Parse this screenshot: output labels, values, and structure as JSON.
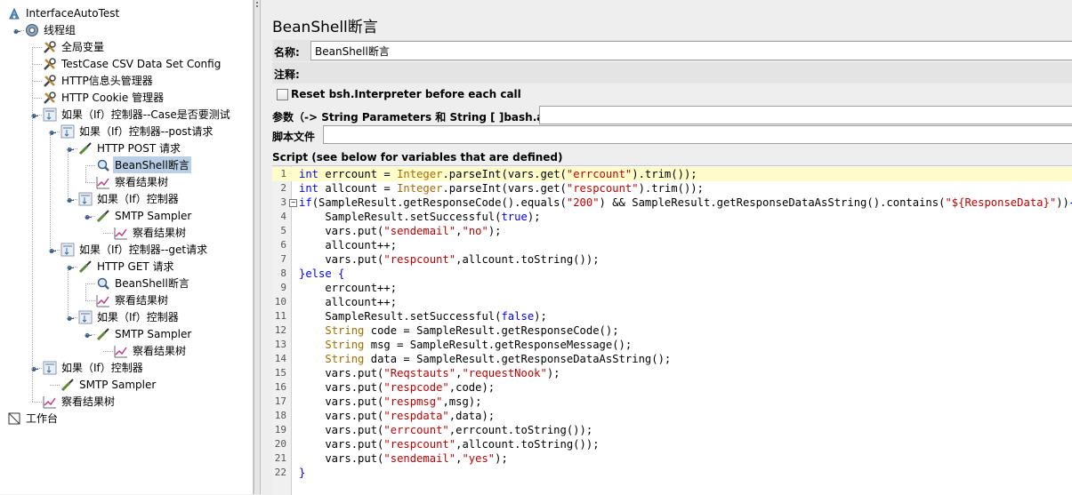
{
  "tree": {
    "items": [
      {
        "label": "InterfaceAutoTest",
        "level": 0,
        "icon": "testplan-icon",
        "toggle": "none",
        "selected": false
      },
      {
        "label": "线程组",
        "level": 1,
        "icon": "gear-icon",
        "toggle": "open",
        "selected": false
      },
      {
        "label": "全局变量",
        "level": 2,
        "icon": "wrench-icon",
        "toggle": "none",
        "selected": false
      },
      {
        "label": "TestCase CSV Data Set Config",
        "level": 2,
        "icon": "wrench-icon",
        "toggle": "none",
        "selected": false
      },
      {
        "label": "HTTP信息头管理器",
        "level": 2,
        "icon": "wrench-icon",
        "toggle": "none",
        "selected": false
      },
      {
        "label": "HTTP Cookie 管理器",
        "level": 2,
        "icon": "wrench-icon",
        "toggle": "none",
        "selected": false
      },
      {
        "label": "如果（If）控制器--Case是否要测试",
        "level": 2,
        "icon": "controller-icon",
        "toggle": "open",
        "selected": false
      },
      {
        "label": "如果（If）控制器--post请求",
        "level": 3,
        "icon": "controller-icon",
        "toggle": "open",
        "selected": false
      },
      {
        "label": "HTTP POST 请求",
        "level": 4,
        "icon": "pipette-icon",
        "toggle": "open",
        "selected": false
      },
      {
        "label": "BeanShell断言",
        "level": 5,
        "icon": "magnifier-icon",
        "toggle": "none",
        "selected": true
      },
      {
        "label": "察看结果树",
        "level": 5,
        "icon": "graph-icon",
        "toggle": "none",
        "selected": false
      },
      {
        "label": "如果（If）控制器",
        "level": 4,
        "icon": "controller-icon",
        "toggle": "open",
        "selected": false
      },
      {
        "label": "SMTP Sampler",
        "level": 5,
        "icon": "pipette-icon",
        "toggle": "open",
        "selected": false
      },
      {
        "label": "察看结果树",
        "level": 6,
        "icon": "graph-icon",
        "toggle": "none",
        "selected": false
      },
      {
        "label": "如果（If）控制器--get请求",
        "level": 3,
        "icon": "controller-icon",
        "toggle": "open",
        "selected": false
      },
      {
        "label": "HTTP GET 请求",
        "level": 4,
        "icon": "pipette-icon",
        "toggle": "open",
        "selected": false
      },
      {
        "label": "BeanShell断言",
        "level": 5,
        "icon": "magnifier-icon",
        "toggle": "none",
        "selected": false
      },
      {
        "label": "察看结果树",
        "level": 5,
        "icon": "graph-icon",
        "toggle": "none",
        "selected": false
      },
      {
        "label": "如果（If）控制器",
        "level": 4,
        "icon": "controller-icon",
        "toggle": "open",
        "selected": false
      },
      {
        "label": "SMTP Sampler",
        "level": 5,
        "icon": "pipette-icon",
        "toggle": "open",
        "selected": false
      },
      {
        "label": "察看结果树",
        "level": 6,
        "icon": "graph-icon",
        "toggle": "none",
        "selected": false
      },
      {
        "label": "如果（If）控制器",
        "level": 2,
        "icon": "controller-icon",
        "toggle": "open",
        "selected": false
      },
      {
        "label": "SMTP Sampler",
        "level": 3,
        "icon": "pipette-icon",
        "toggle": "none",
        "selected": false
      },
      {
        "label": "察看结果树",
        "level": 2,
        "icon": "graph-icon",
        "toggle": "none",
        "selected": false
      },
      {
        "label": "工作台",
        "level": 0,
        "icon": "workbench-icon",
        "toggle": "none",
        "selected": false
      }
    ]
  },
  "panel": {
    "title": "BeanShell断言",
    "name_label": "名称:",
    "name_value": "BeanShell断言",
    "comment_label": "注释:",
    "comment_value": "",
    "reset_label": "Reset bsh.Interpreter before each call",
    "reset_checked": false,
    "params_label": "参数（-> String Parameters 和 String [ ]bash.args）",
    "params_value": "",
    "script_file_label": "脚本文件",
    "script_file_value": "",
    "script_label": "Script (see below for variables that are defined)"
  },
  "script": {
    "highlighted_line": 1,
    "fold_line": 3,
    "lines": [
      [
        [
          "kw",
          "int"
        ],
        [
          "p",
          " errcount = "
        ],
        [
          "ty",
          "Integer"
        ],
        [
          "p",
          ".parseInt(vars.get("
        ],
        [
          "st",
          "\"errcount\""
        ],
        [
          "p",
          ").trim());"
        ]
      ],
      [
        [
          "kw",
          "int"
        ],
        [
          "p",
          " allcount = "
        ],
        [
          "ty",
          "Integer"
        ],
        [
          "p",
          ".parseInt(vars.get("
        ],
        [
          "st",
          "\"respcount\""
        ],
        [
          "p",
          ").trim());"
        ]
      ],
      [
        [
          "kw",
          "if"
        ],
        [
          "p",
          "(SampleResult.getResponseCode().equals("
        ],
        [
          "st",
          "\"200\""
        ],
        [
          "p",
          ") && SampleResult.getResponseDataAsString().contains("
        ],
        [
          "st",
          "\"${ResponseData}\""
        ],
        [
          "p",
          "))"
        ],
        [
          "kw",
          "{"
        ]
      ],
      [
        [
          "p",
          "    SampleResult.setSuccessful("
        ],
        [
          "kw",
          "true"
        ],
        [
          "p",
          ");"
        ]
      ],
      [
        [
          "p",
          "    vars.put("
        ],
        [
          "st",
          "\"sendemail\""
        ],
        [
          "p",
          ","
        ],
        [
          "st",
          "\"no\""
        ],
        [
          "p",
          ");"
        ]
      ],
      [
        [
          "p",
          "    allcount++;"
        ]
      ],
      [
        [
          "p",
          "    vars.put("
        ],
        [
          "st",
          "\"respcount\""
        ],
        [
          "p",
          ",allcount.toString());"
        ]
      ],
      [
        [
          "kw",
          "}"
        ],
        [
          "kw",
          "else"
        ],
        [
          "p",
          " "
        ],
        [
          "kw",
          "{"
        ]
      ],
      [
        [
          "p",
          "    errcount++;"
        ]
      ],
      [
        [
          "p",
          "    allcount++;"
        ]
      ],
      [
        [
          "p",
          "    SampleResult.setSuccessful("
        ],
        [
          "kw",
          "false"
        ],
        [
          "p",
          ");"
        ]
      ],
      [
        [
          "p",
          "    "
        ],
        [
          "ty",
          "String"
        ],
        [
          "p",
          " code = SampleResult.getResponseCode();"
        ]
      ],
      [
        [
          "p",
          "    "
        ],
        [
          "ty",
          "String"
        ],
        [
          "p",
          " msg = SampleResult.getResponseMessage();"
        ]
      ],
      [
        [
          "p",
          "    "
        ],
        [
          "ty",
          "String"
        ],
        [
          "p",
          " data = SampleResult.getResponseDataAsString();"
        ]
      ],
      [
        [
          "p",
          "    vars.put("
        ],
        [
          "st",
          "\"Reqstauts\""
        ],
        [
          "p",
          ","
        ],
        [
          "st",
          "\"requestNook\""
        ],
        [
          "p",
          ");"
        ]
      ],
      [
        [
          "p",
          "    vars.put("
        ],
        [
          "st",
          "\"respcode\""
        ],
        [
          "p",
          ",code);"
        ]
      ],
      [
        [
          "p",
          "    vars.put("
        ],
        [
          "st",
          "\"respmsg\""
        ],
        [
          "p",
          ",msg);"
        ]
      ],
      [
        [
          "p",
          "    vars.put("
        ],
        [
          "st",
          "\"respdata\""
        ],
        [
          "p",
          ",data);"
        ]
      ],
      [
        [
          "p",
          "    vars.put("
        ],
        [
          "st",
          "\"errcount\""
        ],
        [
          "p",
          ",errcount.toString());"
        ]
      ],
      [
        [
          "p",
          "    vars.put("
        ],
        [
          "st",
          "\"respcount\""
        ],
        [
          "p",
          ",allcount.toString());"
        ]
      ],
      [
        [
          "p",
          "    vars.put("
        ],
        [
          "st",
          "\"sendemail\""
        ],
        [
          "p",
          ","
        ],
        [
          "st",
          "\"yes\""
        ],
        [
          "p",
          ");"
        ]
      ],
      [
        [
          "kw",
          "}"
        ]
      ]
    ]
  }
}
